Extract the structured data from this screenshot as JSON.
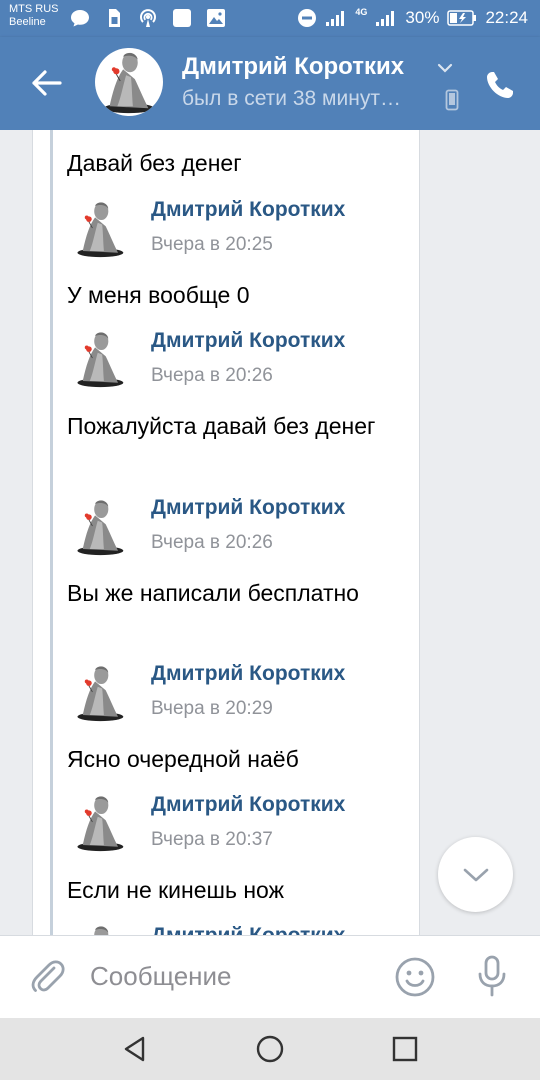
{
  "status_bar": {
    "carrier_line1": "MTS RUS",
    "carrier_line2": "Beeline",
    "network": "4G",
    "battery": "30%",
    "time": "22:24"
  },
  "header": {
    "contact_name": "Дмитрий Коротких",
    "last_seen": "был в сети 38 минут…"
  },
  "messages": [
    {
      "text": "Давай без денег",
      "author": "Дмитрий Коротких",
      "time": "Вчера в 20:25"
    },
    {
      "text": "У меня вообще 0",
      "author": "Дмитрий Коротких",
      "time": "Вчера в 20:26"
    },
    {
      "text": "Пожалуйста давай без денег",
      "author": "Дмитрий Коротких",
      "time": "Вчера в 20:26"
    },
    {
      "text": "Вы же написали бесплатно",
      "author": "Дмитрий Коротких",
      "time": "Вчера в 20:29"
    },
    {
      "text": "Ясно очередной наёб",
      "author": "Дмитрий Коротких",
      "time": "Вчера в 20:37"
    },
    {
      "text": "Если не кинешь нож",
      "author": "Дмитрий Коротких",
      "time": ""
    }
  ],
  "composer": {
    "placeholder": "Сообщение"
  },
  "colors": {
    "header": "#5181b8",
    "author": "#2a5885",
    "background": "#ebedf0"
  },
  "icons": {
    "back": "arrow-left-icon",
    "call": "phone-icon",
    "attach": "paperclip-icon",
    "emoji": "smiley-icon",
    "mic": "microphone-icon",
    "scroll": "chevron-down-icon"
  }
}
